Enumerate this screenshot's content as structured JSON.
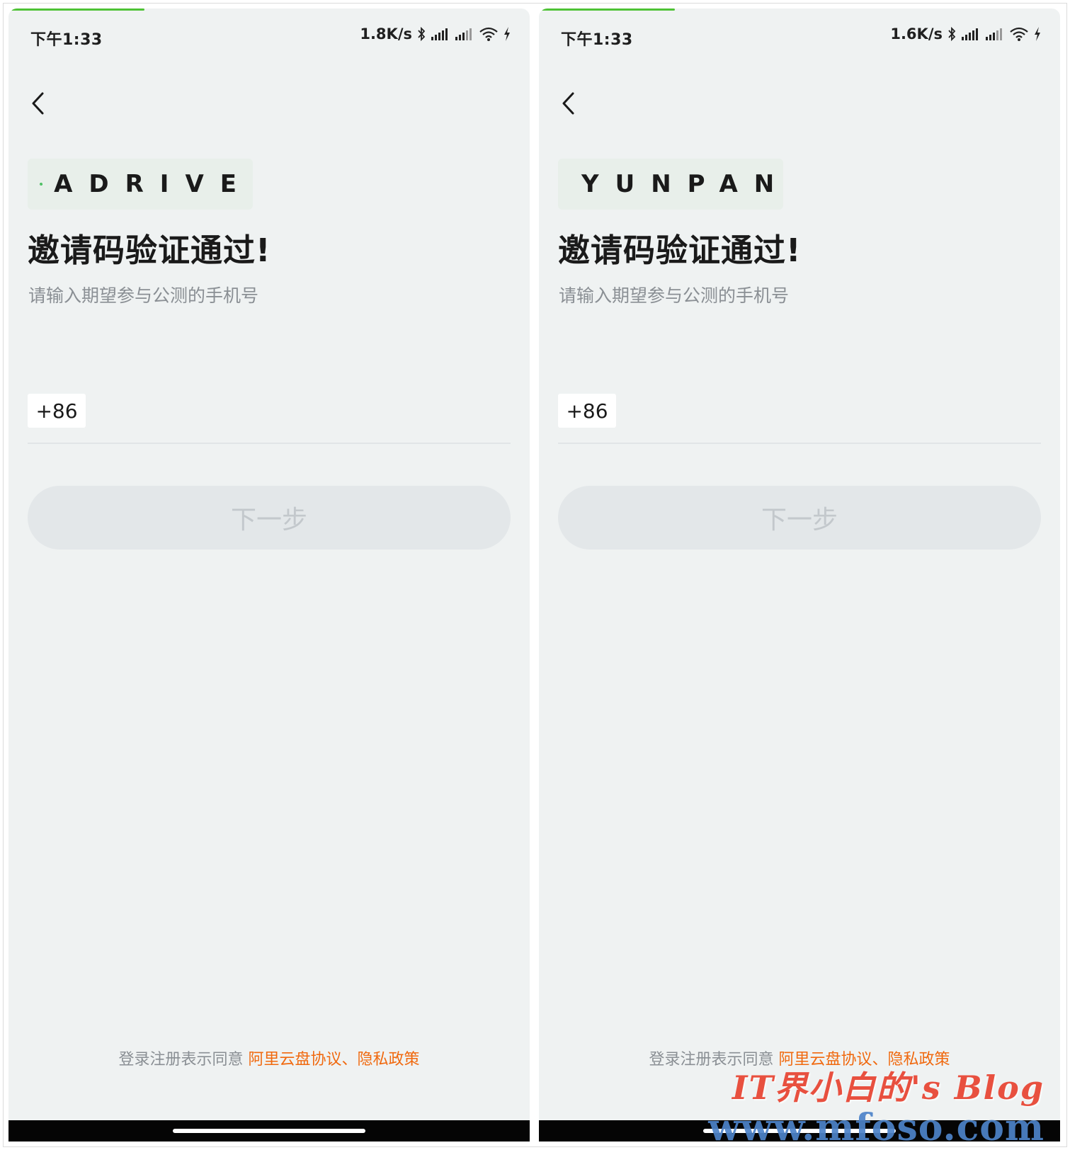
{
  "colors": {
    "background": "#eff2f2",
    "accent_green": "#4ec235",
    "link_orange": "#f0690f",
    "disabled_button": "#e3e7e9"
  },
  "left": {
    "status": {
      "time": "下午1:33",
      "speed": "1.8K/s",
      "icons": [
        "bluetooth-icon",
        "signal-icon",
        "signal-icon",
        "wifi-icon",
        "charging-icon"
      ]
    },
    "brand": "ADRIVE",
    "title": "邀请码验证通过!",
    "subtitle": "请输入期望参与公测的手机号",
    "country_code": "+86",
    "phone_value": "",
    "next_label": "下一步",
    "agreement": {
      "prefix": "登录注册表示同意",
      "link1": "阿里云盘协议",
      "separator": "、",
      "link2": "隐私政策"
    }
  },
  "right": {
    "status": {
      "time": "下午1:33",
      "speed": "1.6K/s",
      "icons": [
        "bluetooth-icon",
        "signal-icon",
        "signal-icon",
        "wifi-icon",
        "charging-icon"
      ]
    },
    "brand": "YUNPAN",
    "title": "邀请码验证通过!",
    "subtitle": "请输入期望参与公测的手机号",
    "country_code": "+86",
    "phone_value": "",
    "next_label": "下一步",
    "agreement": {
      "prefix": "登录注册表示同意",
      "link1": "阿里云盘协议",
      "separator": "、",
      "link2": "隐私政策"
    }
  },
  "watermark": {
    "line1": "IT界小白的's Blog",
    "line2": "www.mfoso.com"
  }
}
